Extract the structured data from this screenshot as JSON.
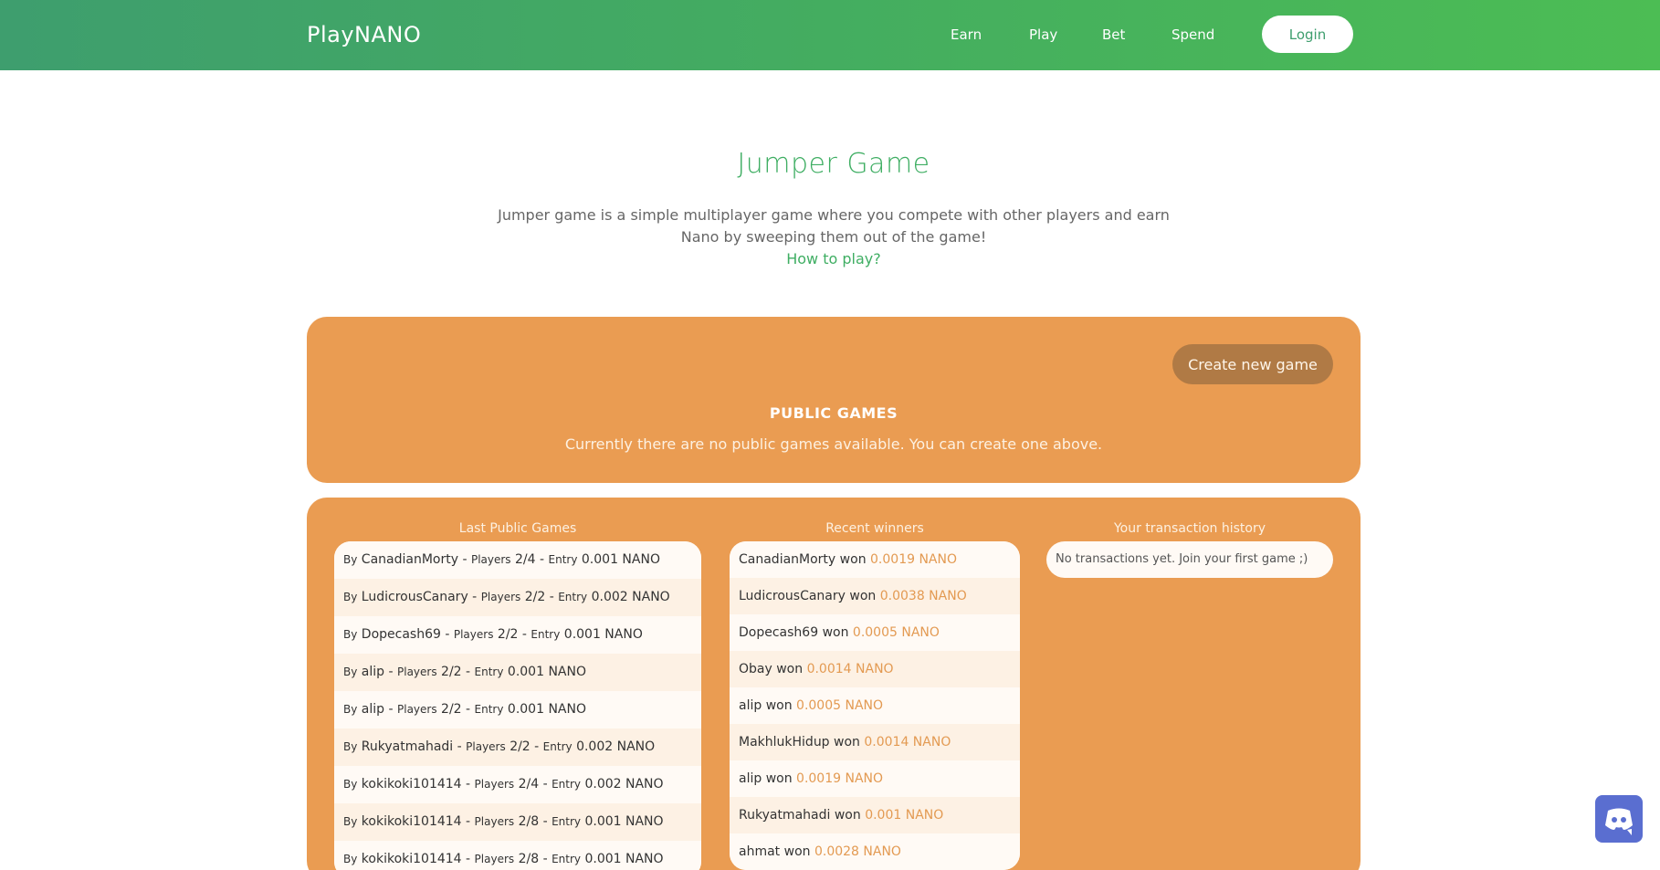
{
  "header": {
    "brand": "PlayNANO",
    "nav": [
      "Earn",
      "Play",
      "Bet",
      "Spend"
    ],
    "login_label": "Login"
  },
  "hero": {
    "title": "Jumper Game",
    "description_line1": "Jumper game is a simple multiplayer game where you compete with other players and earn",
    "description_line2": "Nano by sweeping them out of the game!",
    "how_to_play": "How to play?"
  },
  "public_games": {
    "create_label": "Create new game",
    "title": "PUBLIC GAMES",
    "empty_text": "Currently there are no public games available. You can create one above."
  },
  "last_games": {
    "title": "Last Public Games",
    "rows": [
      {
        "by": "By",
        "name": "CanadianMorty",
        "players_label": "Players",
        "players": "2/4",
        "entry_label": "Entry",
        "entry": "0.001 NANO"
      },
      {
        "by": "By",
        "name": "LudicrousCanary",
        "players_label": "Players",
        "players": "2/2",
        "entry_label": "Entry",
        "entry": "0.002 NANO"
      },
      {
        "by": "By",
        "name": "Dopecash69",
        "players_label": "Players",
        "players": "2/2",
        "entry_label": "Entry",
        "entry": "0.001 NANO"
      },
      {
        "by": "By",
        "name": "alip",
        "players_label": "Players",
        "players": "2/2",
        "entry_label": "Entry",
        "entry": "0.001 NANO"
      },
      {
        "by": "By",
        "name": "alip",
        "players_label": "Players",
        "players": "2/2",
        "entry_label": "Entry",
        "entry": "0.001 NANO"
      },
      {
        "by": "By",
        "name": "Rukyatmahadi",
        "players_label": "Players",
        "players": "2/2",
        "entry_label": "Entry",
        "entry": "0.002 NANO"
      },
      {
        "by": "By",
        "name": "kokikoki101414",
        "players_label": "Players",
        "players": "2/4",
        "entry_label": "Entry",
        "entry": "0.002 NANO"
      },
      {
        "by": "By",
        "name": "kokikoki101414",
        "players_label": "Players",
        "players": "2/8",
        "entry_label": "Entry",
        "entry": "0.001 NANO"
      },
      {
        "by": "By",
        "name": "kokikoki101414",
        "players_label": "Players",
        "players": "2/8",
        "entry_label": "Entry",
        "entry": "0.001 NANO"
      }
    ]
  },
  "recent_winners": {
    "title": "Recent winners",
    "won_label": "won",
    "rows": [
      {
        "name": "CanadianMorty",
        "amount": "0.0019 NANO"
      },
      {
        "name": "LudicrousCanary",
        "amount": "0.0038 NANO"
      },
      {
        "name": "Dopecash69",
        "amount": "0.0005 NANO"
      },
      {
        "name": "Obay",
        "amount": "0.0014 NANO"
      },
      {
        "name": "alip",
        "amount": "0.0005 NANO"
      },
      {
        "name": "MakhlukHidup",
        "amount": "0.0014 NANO"
      },
      {
        "name": "alip",
        "amount": "0.0019 NANO"
      },
      {
        "name": "Rukyatmahadi",
        "amount": "0.001 NANO"
      },
      {
        "name": "ahmat",
        "amount": "0.0028 NANO"
      }
    ]
  },
  "transactions": {
    "title": "Your transaction history",
    "empty_text": "No transactions yet. Join your first game ;)"
  },
  "colors": {
    "header_start": "#3e9e6e",
    "header_end": "#4cbd54",
    "accent_green": "#3fae63",
    "panel_orange": "#ea9c52",
    "create_button": "#b07a45",
    "discord": "#5a6ed0"
  },
  "icons": {
    "discord": "discord-icon"
  }
}
